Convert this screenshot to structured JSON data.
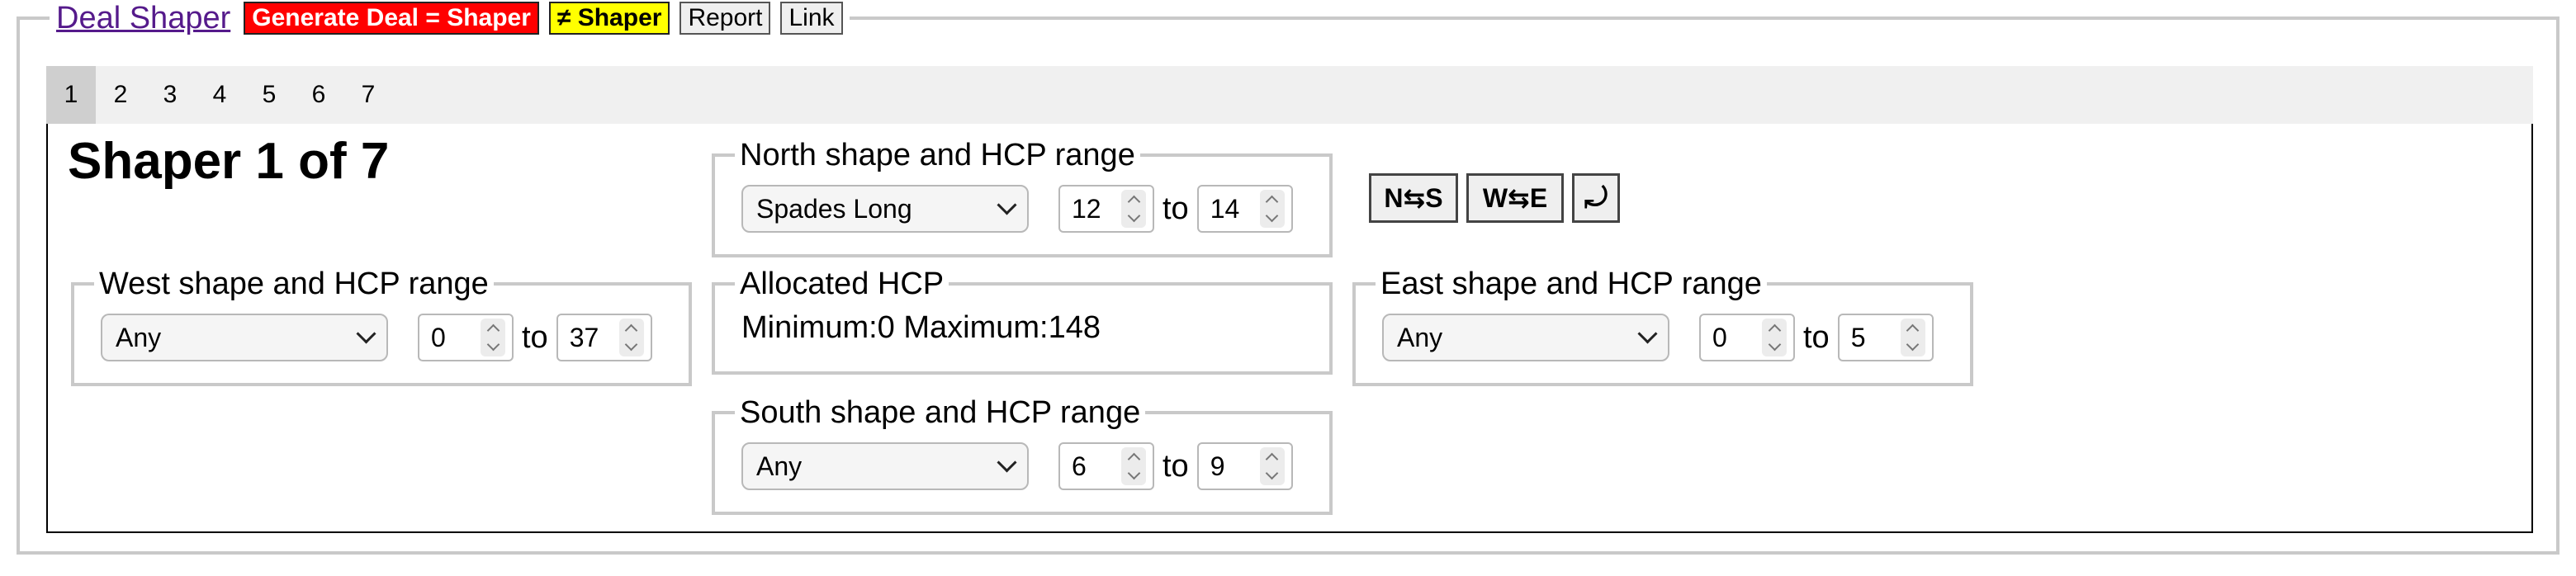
{
  "header": {
    "title": "Deal Shaper",
    "generate_label": "Generate Deal = Shaper",
    "not_shaper_label": "≠ Shaper",
    "report_label": "Report",
    "link_label": "Link"
  },
  "tabs": [
    {
      "label": "1",
      "active": true
    },
    {
      "label": "2"
    },
    {
      "label": "3"
    },
    {
      "label": "4"
    },
    {
      "label": "5"
    },
    {
      "label": "6"
    },
    {
      "label": "7"
    }
  ],
  "panel": {
    "heading": "Shaper 1 of 7",
    "north": {
      "legend": "North shape and HCP range",
      "shape": "Spades Long",
      "min": "12",
      "to": "to",
      "max": "14"
    },
    "west": {
      "legend": "West shape and HCP range",
      "shape": "Any",
      "min": "0",
      "to": "to",
      "max": "37"
    },
    "east": {
      "legend": "East shape and HCP range",
      "shape": "Any",
      "min": "0",
      "to": "to",
      "max": "5"
    },
    "south": {
      "legend": "South shape and HCP range",
      "shape": "Any",
      "min": "6",
      "to": "to",
      "max": "9"
    },
    "allocated": {
      "legend": "Allocated HCP",
      "text": "Minimum:0 Maximum:148"
    },
    "controls": {
      "swap_ns": "N⇆S",
      "swap_we": "W⇆E",
      "rotate": "⤾"
    }
  },
  "colors": {
    "generate_bg": "#ff0000",
    "not_shaper_bg": "#ffff00",
    "link": "#551a8b",
    "active_tab": "#cfcfcf"
  }
}
